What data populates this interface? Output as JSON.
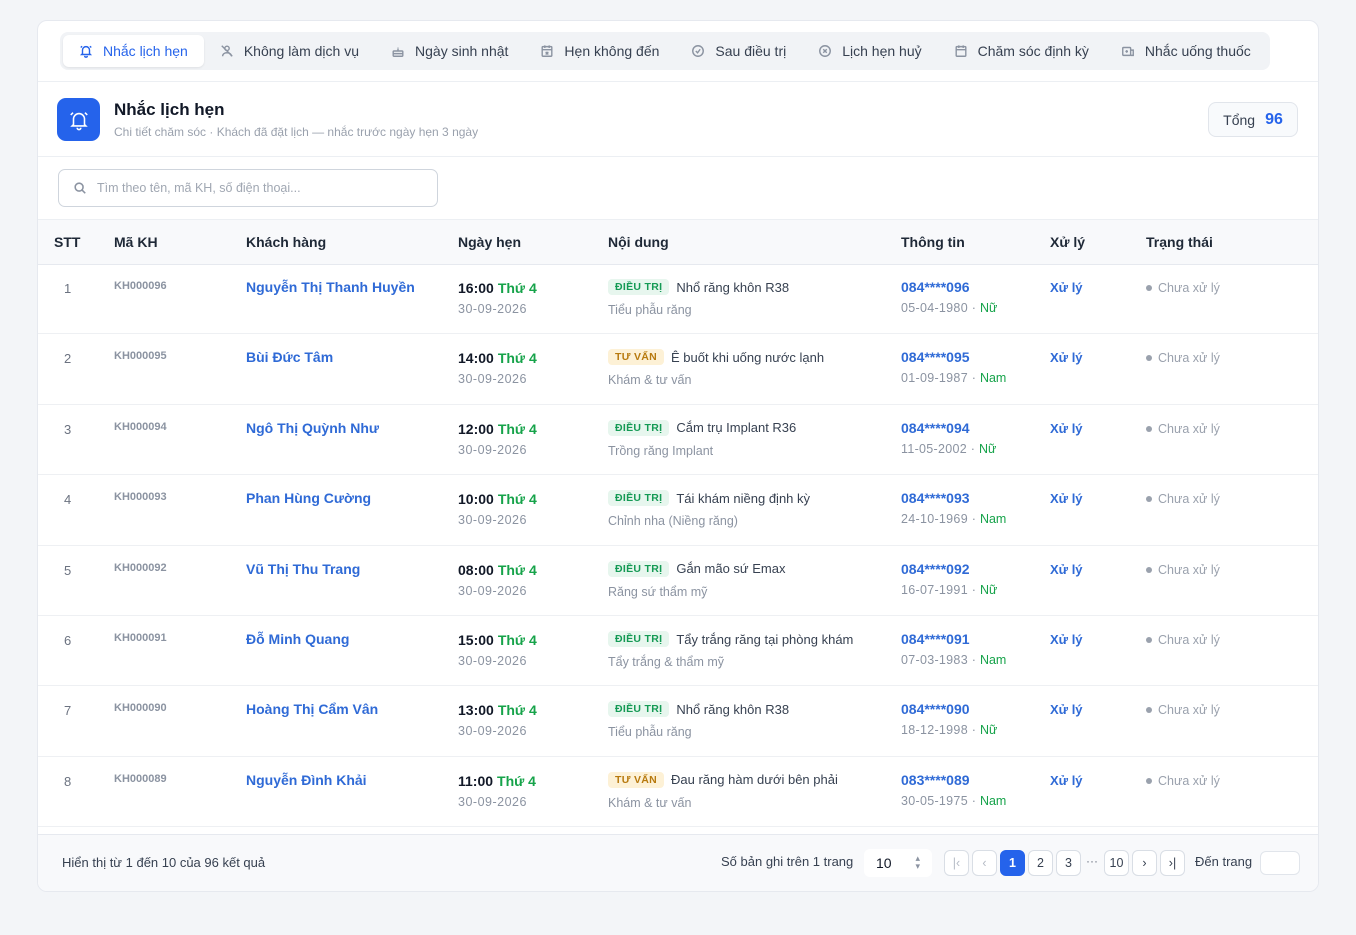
{
  "tabs": [
    {
      "label": "Nhắc lịch hẹn",
      "icon": "bell-icon",
      "active": true
    },
    {
      "label": "Không làm dịch vụ",
      "icon": "user-off-icon"
    },
    {
      "label": "Ngày sinh nhật",
      "icon": "cake-icon"
    },
    {
      "label": "Hẹn không đến",
      "icon": "calendar-x-icon"
    },
    {
      "label": "Sau điều trị",
      "icon": "check-circle-icon"
    },
    {
      "label": "Lịch hẹn huỷ",
      "icon": "x-circle-icon"
    },
    {
      "label": "Chăm sóc định kỳ",
      "icon": "calendar-icon"
    },
    {
      "label": "Nhắc uống thuốc",
      "icon": "pill-icon"
    }
  ],
  "header": {
    "title": "Nhắc lịch hẹn",
    "subtitle": "Chi tiết chăm sóc · Khách đã đặt lịch — nhắc trước ngày hẹn 3 ngày",
    "total_label": "Tổng",
    "total_value": "96"
  },
  "search": {
    "placeholder": "Tìm theo tên, mã KH, số điện thoại..."
  },
  "columns": [
    "STT",
    "Mã KH",
    "Khách hàng",
    "Ngày hẹn",
    "Nội dung",
    "Thông tin",
    "Xử lý",
    "Trạng thái"
  ],
  "rows": [
    {
      "stt": "1",
      "ma": "KH000096",
      "name": "Nguyễn Thị Thanh Huyền",
      "time": "16:00",
      "weekday": "Thứ 4",
      "date": "30-09-2026",
      "tag": "ĐIỀU TRỊ",
      "tag_type": "dt",
      "content": "Nhổ răng khôn R38",
      "service": "Tiểu phẫu răng",
      "phone": "084****096",
      "dob": "05-04-1980 · ",
      "gender": "Nữ",
      "action": "Xử lý",
      "status": "Chưa xử lý"
    },
    {
      "stt": "2",
      "ma": "KH000095",
      "name": "Bùi Đức Tâm",
      "time": "14:00",
      "weekday": "Thứ 4",
      "date": "30-09-2026",
      "tag": "TƯ VẤN",
      "tag_type": "tv",
      "content": "Ê buốt khi uống nước lạnh",
      "service": "Khám & tư vấn",
      "phone": "084****095",
      "dob": "01-09-1987 · ",
      "gender": "Nam",
      "action": "Xử lý",
      "status": "Chưa xử lý"
    },
    {
      "stt": "3",
      "ma": "KH000094",
      "name": "Ngô Thị Quỳnh Như",
      "time": "12:00",
      "weekday": "Thứ 4",
      "date": "30-09-2026",
      "tag": "ĐIỀU TRỊ",
      "tag_type": "dt",
      "content": "Cắm trụ Implant R36",
      "service": "Trồng răng Implant",
      "phone": "084****094",
      "dob": "11-05-2002 · ",
      "gender": "Nữ",
      "action": "Xử lý",
      "status": "Chưa xử lý"
    },
    {
      "stt": "4",
      "ma": "KH000093",
      "name": "Phan Hùng Cường",
      "time": "10:00",
      "weekday": "Thứ 4",
      "date": "30-09-2026",
      "tag": "ĐIỀU TRỊ",
      "tag_type": "dt",
      "content": "Tái khám niềng định kỳ",
      "service": "Chỉnh nha (Niềng răng)",
      "phone": "084****093",
      "dob": "24-10-1969 · ",
      "gender": "Nam",
      "action": "Xử lý",
      "status": "Chưa xử lý"
    },
    {
      "stt": "5",
      "ma": "KH000092",
      "name": "Vũ Thị Thu Trang",
      "time": "08:00",
      "weekday": "Thứ 4",
      "date": "30-09-2026",
      "tag": "ĐIỀU TRỊ",
      "tag_type": "dt",
      "content": "Gắn mão sứ Emax",
      "service": "Răng sứ thẩm mỹ",
      "phone": "084****092",
      "dob": "16-07-1991 · ",
      "gender": "Nữ",
      "action": "Xử lý",
      "status": "Chưa xử lý"
    },
    {
      "stt": "6",
      "ma": "KH000091",
      "name": "Đỗ Minh Quang",
      "time": "15:00",
      "weekday": "Thứ 4",
      "date": "30-09-2026",
      "tag": "ĐIỀU TRỊ",
      "tag_type": "dt",
      "content": "Tẩy trắng răng tại phòng khám",
      "service": "Tẩy trắng & thẩm mỹ",
      "phone": "084****091",
      "dob": "07-03-1983 · ",
      "gender": "Nam",
      "action": "Xử lý",
      "status": "Chưa xử lý"
    },
    {
      "stt": "7",
      "ma": "KH000090",
      "name": "Hoàng Thị Cẩm Vân",
      "time": "13:00",
      "weekday": "Thứ 4",
      "date": "30-09-2026",
      "tag": "ĐIỀU TRỊ",
      "tag_type": "dt",
      "content": "Nhổ răng khôn R38",
      "service": "Tiểu phẫu răng",
      "phone": "084****090",
      "dob": "18-12-1998 · ",
      "gender": "Nữ",
      "action": "Xử lý",
      "status": "Chưa xử lý"
    },
    {
      "stt": "8",
      "ma": "KH000089",
      "name": "Nguyễn Đình Khải",
      "time": "11:00",
      "weekday": "Thứ 4",
      "date": "30-09-2026",
      "tag": "TƯ VẤN",
      "tag_type": "tv",
      "content": "Đau răng hàm dưới bên phải",
      "service": "Khám & tư vấn",
      "phone": "083****089",
      "dob": "30-05-1975 · ",
      "gender": "Nam",
      "action": "Xử lý",
      "status": "Chưa xử lý"
    }
  ],
  "footer": {
    "info": "Hiển thị từ 1 đến 10 của 96 kết quả",
    "per_page_label": "Số bản ghi trên 1 trang",
    "per_page_value": "10",
    "pages": [
      "1",
      "2",
      "3",
      "10"
    ],
    "ellipsis": "···",
    "goto_label": "Đến trang"
  }
}
